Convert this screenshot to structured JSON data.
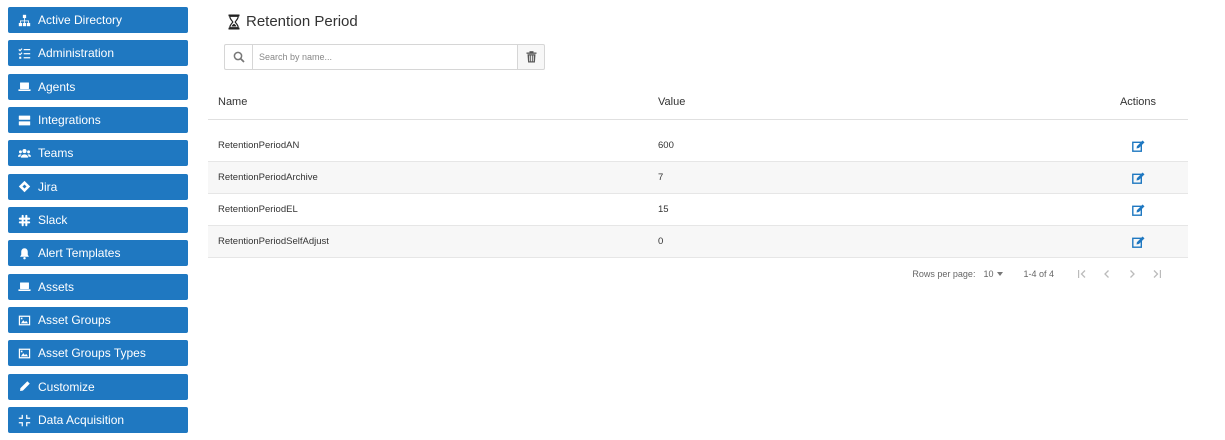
{
  "sidebar": {
    "items": [
      {
        "label": "Active Directory",
        "icon": "sitemap-icon"
      },
      {
        "label": "Administration",
        "icon": "list-check-icon"
      },
      {
        "label": "Agents",
        "icon": "laptop-icon"
      },
      {
        "label": "Integrations",
        "icon": "server-icon"
      },
      {
        "label": "Teams",
        "icon": "users-icon"
      },
      {
        "label": "Jira",
        "icon": "jira-icon"
      },
      {
        "label": "Slack",
        "icon": "slack-icon"
      },
      {
        "label": "Alert Templates",
        "icon": "bell-icon"
      },
      {
        "label": "Assets",
        "icon": "laptop-icon"
      },
      {
        "label": "Asset Groups",
        "icon": "image-icon"
      },
      {
        "label": "Asset Groups Types",
        "icon": "image-icon"
      },
      {
        "label": "Customize",
        "icon": "pencil-icon"
      },
      {
        "label": "Data Acquisition",
        "icon": "compress-icon"
      }
    ]
  },
  "page": {
    "title": "Retention Period",
    "title_icon": "hourglass-icon"
  },
  "search": {
    "placeholder": "Search by name...",
    "value": ""
  },
  "table": {
    "headers": {
      "name": "Name",
      "value": "Value",
      "actions": "Actions"
    },
    "rows": [
      {
        "name": "RetentionPeriodAN",
        "value": "600"
      },
      {
        "name": "RetentionPeriodArchive",
        "value": "7"
      },
      {
        "name": "RetentionPeriodEL",
        "value": "15"
      },
      {
        "name": "RetentionPeriodSelfAdjust",
        "value": "0"
      }
    ]
  },
  "pagination": {
    "rows_per_page_label": "Rows per page:",
    "rows_per_page": "10",
    "range": "1-4 of 4"
  },
  "colors": {
    "sidebar_bg": "#1f78c1",
    "edit_icon": "#1f78c1"
  }
}
